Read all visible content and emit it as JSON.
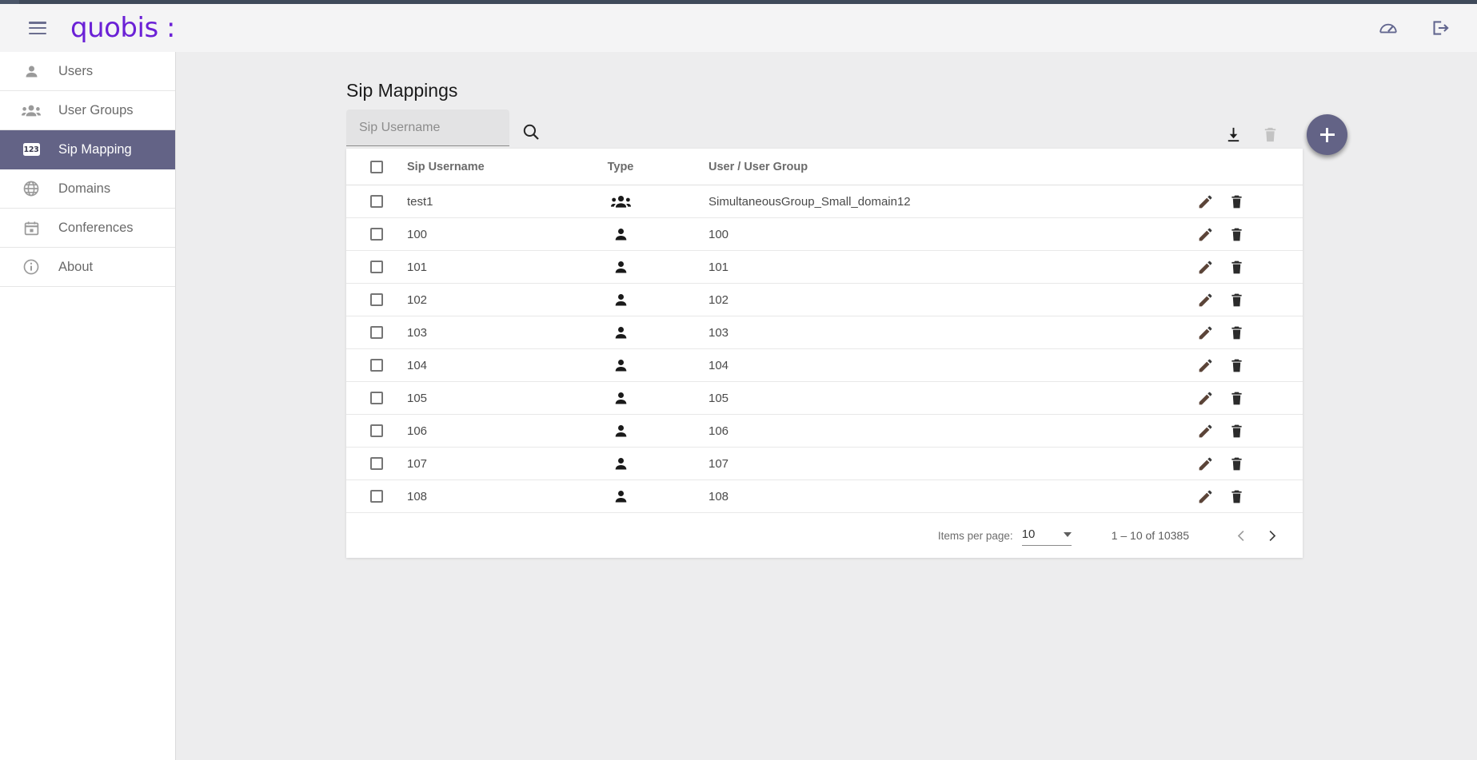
{
  "header": {
    "menu_icon": "hamburger-menu-icon",
    "brand": "quobis :",
    "dashboard_icon": "speedometer-icon",
    "logout_icon": "logout-icon"
  },
  "sidebar": {
    "items": [
      {
        "label": "Users",
        "icon": "person-icon",
        "active": false
      },
      {
        "label": "User Groups",
        "icon": "people-icon",
        "active": false
      },
      {
        "label": "Sip Mapping",
        "icon": "numbers-123-icon",
        "active": true
      },
      {
        "label": "Domains",
        "icon": "globe-icon",
        "active": false
      },
      {
        "label": "Conferences",
        "icon": "calendar-icon",
        "active": false
      },
      {
        "label": "About",
        "icon": "info-icon",
        "active": false
      }
    ]
  },
  "main": {
    "title": "Sip Mappings",
    "search": {
      "placeholder": "Sip Username",
      "value": "",
      "search_icon": "search-icon"
    },
    "toolbar": {
      "download_icon": "download-icon",
      "delete_icon": "trash-icon",
      "add_icon": "plus-icon"
    },
    "table": {
      "columns": [
        "Sip Username",
        "Type",
        "User / User Group"
      ],
      "rows": [
        {
          "sip_username": "test1",
          "type": "group",
          "user_group": "SimultaneousGroup_Small_domain12"
        },
        {
          "sip_username": "100",
          "type": "person",
          "user_group": "100"
        },
        {
          "sip_username": "101",
          "type": "person",
          "user_group": "101"
        },
        {
          "sip_username": "102",
          "type": "person",
          "user_group": "102"
        },
        {
          "sip_username": "103",
          "type": "person",
          "user_group": "103"
        },
        {
          "sip_username": "104",
          "type": "person",
          "user_group": "104"
        },
        {
          "sip_username": "105",
          "type": "person",
          "user_group": "105"
        },
        {
          "sip_username": "106",
          "type": "person",
          "user_group": "106"
        },
        {
          "sip_username": "107",
          "type": "person",
          "user_group": "107"
        },
        {
          "sip_username": "108",
          "type": "person",
          "user_group": "108"
        }
      ],
      "row_actions": {
        "edit_icon": "pencil-icon",
        "delete_icon": "trash-icon"
      }
    },
    "paginator": {
      "items_per_page_label": "Items per page:",
      "items_per_page_value": "10",
      "range_label": "1 – 10 of 10385",
      "prev_icon": "chevron-left-icon",
      "next_icon": "chevron-right-icon"
    }
  },
  "colors": {
    "brand_purple": "#6b21d6",
    "accent_slate": "#636386",
    "page_bg": "#ededee",
    "header_bg": "#f4f4f5"
  }
}
